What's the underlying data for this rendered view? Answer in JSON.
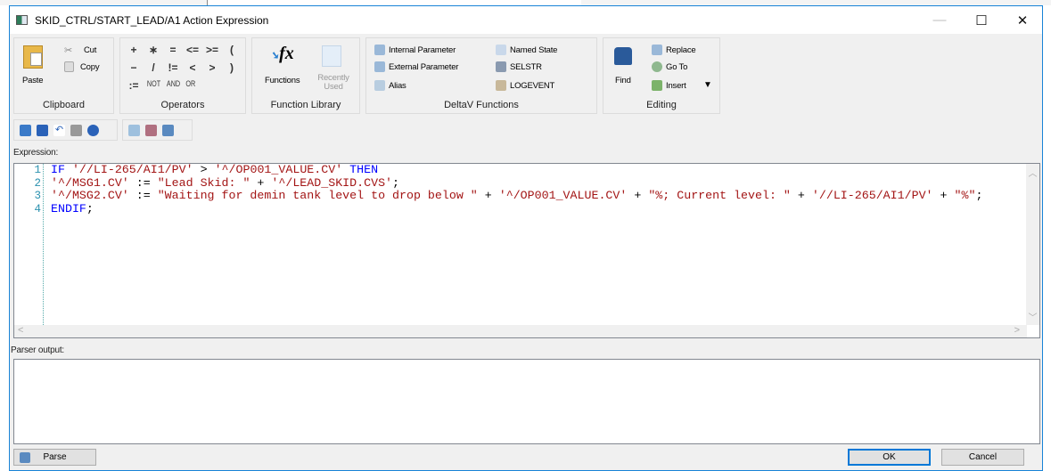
{
  "window": {
    "title": "SKID_CTRL/START_LEAD/A1 Action Expression",
    "minimize": "—",
    "maximize": "☐",
    "close": "✕"
  },
  "ribbon": {
    "clipboard": {
      "label": "Clipboard",
      "paste": "Paste",
      "cut": "Cut",
      "copy": "Copy"
    },
    "operators": {
      "label": "Operators",
      "items": [
        "+",
        "∗",
        "=",
        "<=",
        ">=",
        "(",
        "−",
        "/",
        "!=",
        "<",
        ">",
        ")",
        ":=",
        "NOT",
        "AND",
        "OR"
      ]
    },
    "function_library": {
      "label": "Function Library",
      "functions": "Functions",
      "recently_used": "Recently Used"
    },
    "deltav": {
      "label": "DeltaV Functions",
      "internal": "Internal Parameter",
      "external": "External Parameter",
      "alias": "Alias",
      "named_state": "Named State",
      "selstr": "SELSTR",
      "logevent": "LOGEVENT"
    },
    "editing": {
      "label": "Editing",
      "find": "Find",
      "replace": "Replace",
      "goto": "Go To",
      "insert": "Insert"
    }
  },
  "expression": {
    "label": "Expression:",
    "line_numbers": [
      "1",
      "2",
      "3",
      "4"
    ],
    "lines": [
      [
        [
          "kw",
          "IF "
        ],
        [
          "str",
          "'//LI-265/AI1/PV'"
        ],
        [
          "pl",
          " > "
        ],
        [
          "str",
          "'^/OP001_VALUE.CV'"
        ],
        [
          "kw",
          " THEN"
        ]
      ],
      [
        [
          "str",
          "'^/MSG1.CV'"
        ],
        [
          "pl",
          " := "
        ],
        [
          "str",
          "\"Lead Skid: \""
        ],
        [
          "pl",
          " + "
        ],
        [
          "str",
          "'^/LEAD_SKID.CVS'"
        ],
        [
          "pl",
          ";"
        ]
      ],
      [
        [
          "str",
          "'^/MSG2.CV'"
        ],
        [
          "pl",
          " := "
        ],
        [
          "str",
          "\"Waiting for demin tank level to drop below \""
        ],
        [
          "pl",
          " + "
        ],
        [
          "str",
          "'^/OP001_VALUE.CV'"
        ],
        [
          "pl",
          " + "
        ],
        [
          "str",
          "\"%; Current level: \""
        ],
        [
          "pl",
          " + "
        ],
        [
          "str",
          "'//LI-265/AI1/PV'"
        ],
        [
          "pl",
          " + "
        ],
        [
          "str",
          "\"%\""
        ],
        [
          "pl",
          ";"
        ]
      ],
      [
        [
          "kw",
          "ENDIF"
        ],
        [
          "pl",
          ";"
        ]
      ]
    ]
  },
  "parser": {
    "label": "Parser output:",
    "text": ""
  },
  "buttons": {
    "parse": "Parse",
    "ok": "OK",
    "cancel": "Cancel"
  },
  "colors": {
    "keyword": "#0000ff",
    "string": "#a31515",
    "line_number": "#2b91af",
    "accent": "#1883d7"
  }
}
